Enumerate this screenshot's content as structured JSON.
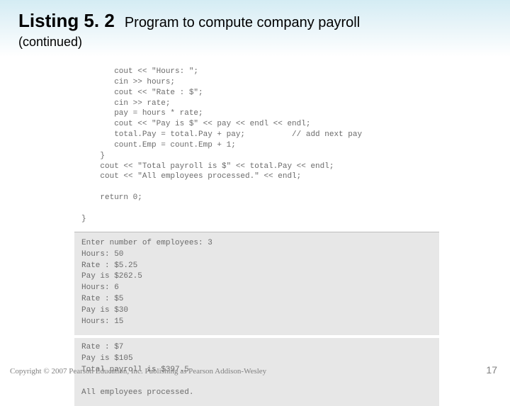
{
  "title": {
    "listing": "Listing 5. 2",
    "desc": "Program to compute company payroll",
    "continued": "(continued)"
  },
  "code": "       cout << \"Hours: \";\n       cin >> hours;\n       cout << \"Rate : $\";\n       cin >> rate;\n       pay = hours * rate;\n       cout << \"Pay is $\" << pay << endl << endl;\n       total.Pay = total.Pay + pay;          // add next pay\n       count.Emp = count.Emp + 1;\n    }\n    cout << \"Total payroll is $\" << total.Pay << endl;\n    cout << \"All employees processed.\" << endl;\n\n    return 0;\n\n}",
  "output1": "Enter number of employees: 3\nHours: 50\nRate : $5.25\nPay is $262.5\nHours: 6\nRate : $5\nPay is $30\nHours: 15",
  "output2": "Rate : $7\nPay is $105\nTotal payroll is $397.5\n\nAll employees processed.",
  "footer": {
    "copyright": "Copyright © 2007 Pearson Education, Inc. Publishing as Pearson Addison-Wesley",
    "page": "17"
  }
}
